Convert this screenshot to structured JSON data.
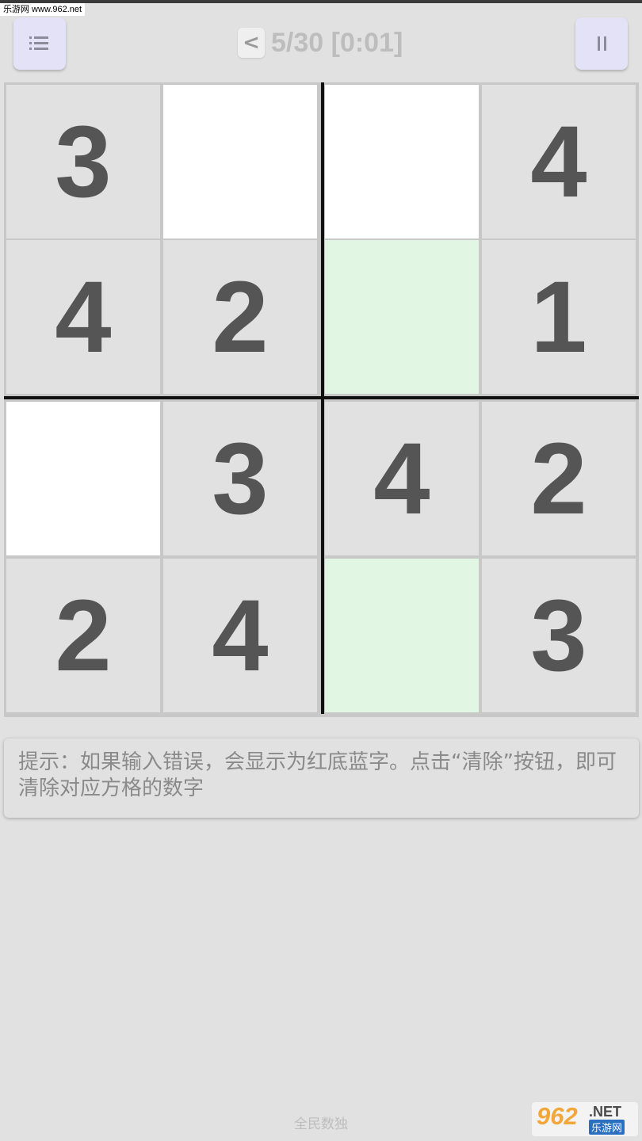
{
  "watermark": {
    "text": "乐游网 www.962.net"
  },
  "header": {
    "back_label": "<",
    "title": "5/30 [0:01]",
    "menu_icon": "list-icon",
    "pause_icon": "pause-icon"
  },
  "board": {
    "size": 4,
    "cells": [
      {
        "value": "3",
        "state": "given"
      },
      {
        "value": "",
        "state": "empty"
      },
      {
        "value": "",
        "state": "empty"
      },
      {
        "value": "4",
        "state": "given"
      },
      {
        "value": "4",
        "state": "given"
      },
      {
        "value": "2",
        "state": "given"
      },
      {
        "value": "",
        "state": "highlighted"
      },
      {
        "value": "1",
        "state": "given"
      },
      {
        "value": "",
        "state": "empty"
      },
      {
        "value": "3",
        "state": "given"
      },
      {
        "value": "4",
        "state": "given"
      },
      {
        "value": "2",
        "state": "given"
      },
      {
        "value": "2",
        "state": "given"
      },
      {
        "value": "4",
        "state": "given"
      },
      {
        "value": "",
        "state": "highlighted"
      },
      {
        "value": "3",
        "state": "given"
      }
    ]
  },
  "hint": {
    "text": "提示：如果输入错误，会显示为红底蓝字。点击“清除”按钮，即可清除对应方格的数字"
  },
  "footer": {
    "app_name": "全民数独"
  },
  "logo": {
    "main": "962",
    "suffix": ".NET",
    "sub": "乐游网"
  },
  "colors": {
    "background": "#e1e1e1",
    "digit": "#555555",
    "highlight": "#e1f7e3",
    "button": "#e3e2f6"
  }
}
